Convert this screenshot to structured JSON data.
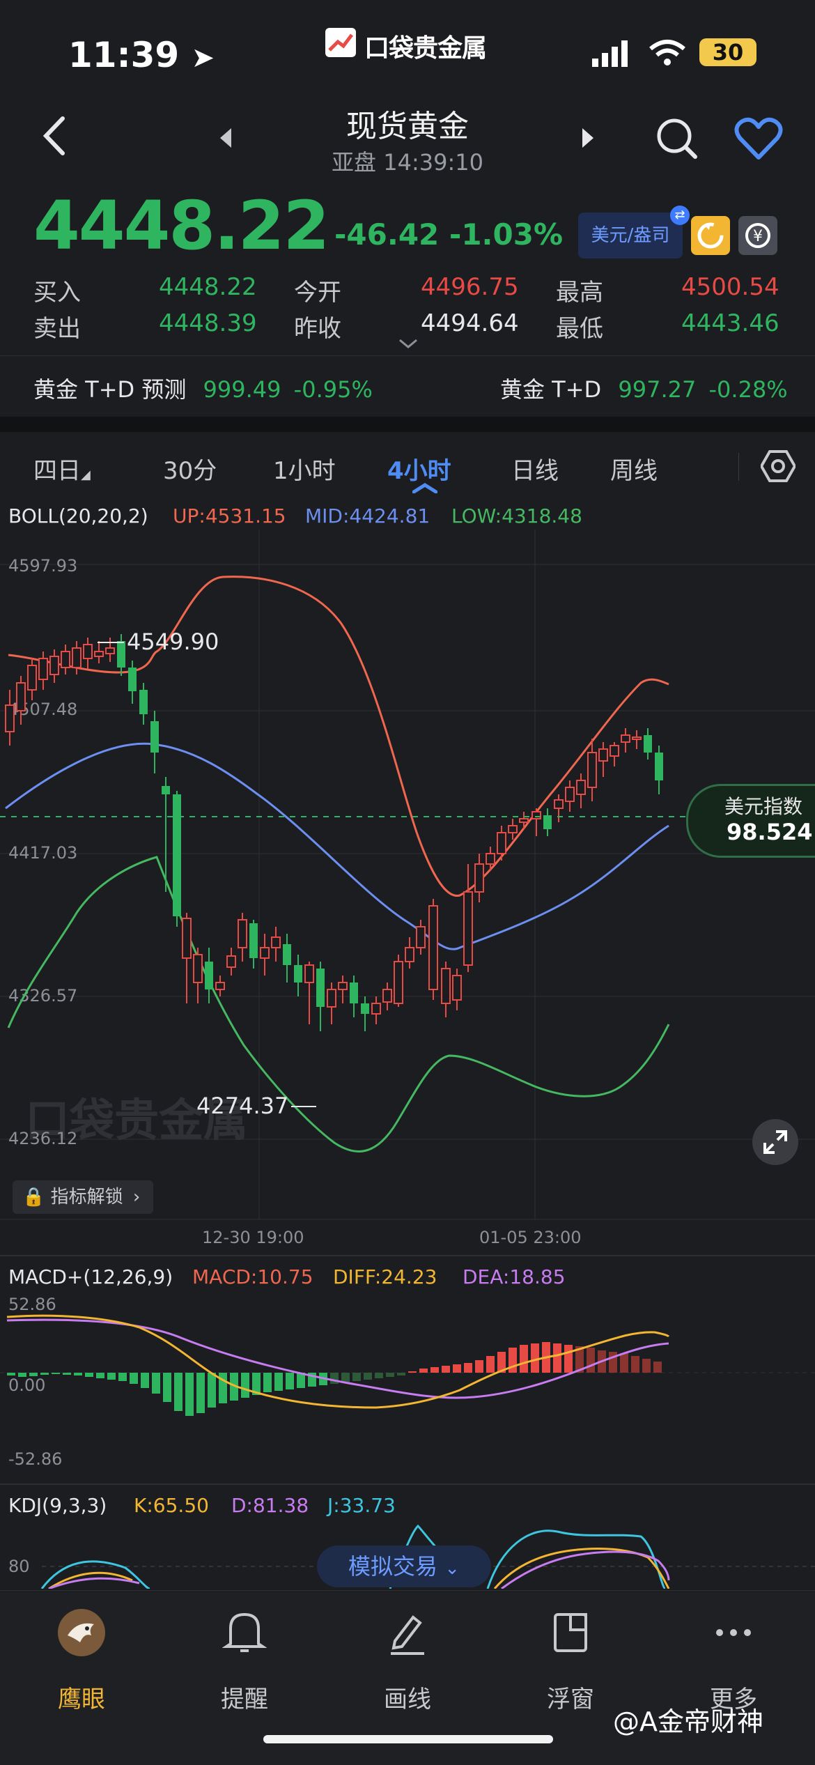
{
  "status_bar": {
    "time": "11:39",
    "battery": "30",
    "logo": "口袋贵金属"
  },
  "header": {
    "title": "现货黄金",
    "subtitle": "亚盘 14:39:10"
  },
  "quote": {
    "price": "4448.22",
    "change": "-46.42 -1.03%",
    "currency_chip": "美元/盎司",
    "buy_label": "买入",
    "buy_value": "4448.22",
    "sell_label": "卖出",
    "sell_value": "4448.39",
    "open_label": "今开",
    "open_value": "4496.75",
    "prev_close_label": "昨收",
    "prev_close_value": "4494.64",
    "high_label": "最高",
    "high_value": "4500.54",
    "low_label": "最低",
    "low_value": "4443.46"
  },
  "related": [
    {
      "name": "黄金 T+D 预测",
      "value": "999.49",
      "change": "-0.95%"
    },
    {
      "name": "黄金 T+D",
      "value": "997.27",
      "change": "-0.28%"
    }
  ],
  "period_tabs": [
    "四日",
    "30分",
    "1小时",
    "4小时",
    "日线",
    "周线"
  ],
  "active_period": "4小时",
  "chart": {
    "boll_label": "BOLL(20,20,2)",
    "boll_up": "UP:4531.15",
    "boll_mid": "MID:4424.81",
    "boll_low": "LOW:4318.48",
    "y_ticks": [
      "4597.93",
      "4507.48",
      "4417.03",
      "4326.57",
      "4236.12"
    ],
    "high_marker": "4549.90",
    "low_marker": "4274.37",
    "x_ticks": [
      "12-30 19:00",
      "01-05 23:00"
    ],
    "unlock_label": "指标解锁",
    "dxy_label": "美元指数",
    "dxy_value": "98.524",
    "watermark_logo": "口袋贵金属"
  },
  "macd": {
    "label": "MACD+(12,26,9)",
    "macd": "MACD:10.75",
    "diff": "DIFF:24.23",
    "dea": "DEA:18.85",
    "y_ticks": [
      "52.86",
      "0.00",
      "-52.86"
    ]
  },
  "kdj": {
    "label": "KDJ(9,3,3)",
    "k": "K:65.50",
    "d": "D:81.38",
    "j": "J:33.73",
    "y_tick": "80"
  },
  "sim_trade": "模拟交易",
  "bottom_nav": [
    "鹰眼",
    "提醒",
    "画线",
    "浮窗",
    "更多"
  ],
  "watermark": "@A金帝财神",
  "colors": {
    "up": "#e84a46",
    "down": "#2fb460",
    "accent": "#4f8df5",
    "boll_up": "#f0674f",
    "boll_mid": "#6c8ff0",
    "boll_low": "#45b861"
  }
}
